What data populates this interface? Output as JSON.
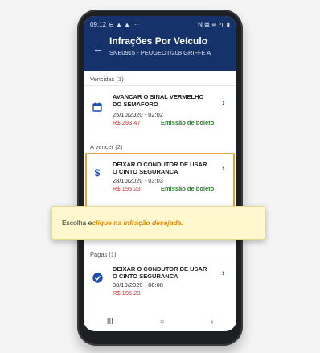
{
  "statusbar": {
    "time": "09:12",
    "left_icons": "⊖ ▲ ▲ ···",
    "right_icons": "N ⊠ ≋ ⁴ıl ▮"
  },
  "header": {
    "title": "Infrações Por Veículo",
    "subtitle": "SNE0915 - PEUGEOT/208 GRIFFE A"
  },
  "sections": [
    {
      "label": "Vencidas (1)"
    },
    {
      "label": "A vencer (2)"
    },
    {
      "label": "Pagas (1)"
    }
  ],
  "items": [
    {
      "icon": "calendar-icon",
      "title": "AVANCAR O SINAL VERMELHO DO SEMAFORO",
      "date": "25/10/2020 - 02:02",
      "amount": "R$ 293,47",
      "status": "Emissão de boleto"
    },
    {
      "icon": "dollar-icon",
      "title": "DEIXAR O CONDUTOR DE USAR O CINTO SEGURANCA",
      "date": "28/10/2020 - 03:03",
      "amount": "R$ 195,23",
      "status": "Emissão de boleto"
    },
    {
      "icon": "check-circle-icon",
      "title": "DEIXAR O CONDUTOR DE USAR O CINTO SEGURANCA",
      "date": "30/10/2020 - 08:08",
      "amount": "R$ 195,23",
      "status": ""
    }
  ],
  "tooltip": {
    "prefix": "Escolha e ",
    "emphasis": "clique na infração desejada",
    "suffix": "."
  },
  "navbar": {
    "recent": "III",
    "home": "○",
    "back": "‹"
  },
  "colors": {
    "header": "#16326a",
    "accent": "#1e4fa8",
    "amount": "#d32f2f",
    "status": "#2e7d32",
    "highlight": "#e0a23a",
    "tooltip_bg": "#fff8cf"
  }
}
